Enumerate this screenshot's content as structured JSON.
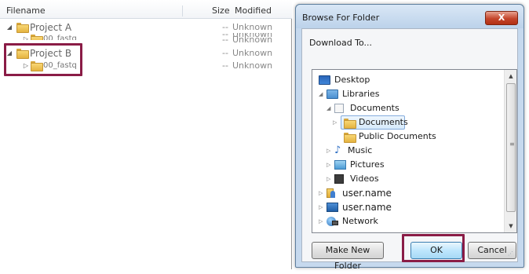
{
  "file_panel": {
    "columns": {
      "filename": "Filename",
      "size": "Size",
      "modified": "Modified"
    },
    "rows": [
      {
        "name": "Project A",
        "size": "--",
        "modified": "Unknown",
        "level": 0,
        "expanded": true
      },
      {
        "name": "00_fastq",
        "size": "--",
        "modified": "Unknown",
        "level": 1,
        "expanded": false
      },
      {
        "name": "Project B",
        "size": "--",
        "modified": "Unknown",
        "level": 0,
        "expanded": true
      },
      {
        "name": "00_fastq",
        "size": "--",
        "modified": "Unknown",
        "level": 1,
        "expanded": false
      }
    ]
  },
  "dialog": {
    "title": "Browse For Folder",
    "close_label": "X",
    "subtitle": "Download To...",
    "tree": [
      {
        "label": "Desktop",
        "icon": "desktop-icon",
        "caret": ""
      },
      {
        "label": "Libraries",
        "icon": "libraries-icon",
        "caret": "expanded"
      },
      {
        "label": "Documents",
        "icon": "documents-library-icon",
        "caret": "expanded"
      },
      {
        "label": "Documents",
        "icon": "folder-icon",
        "caret": "collapsed",
        "selected": true
      },
      {
        "label": "Public Documents",
        "icon": "folder-icon",
        "caret": ""
      },
      {
        "label": "Music",
        "icon": "music-icon",
        "caret": "collapsed"
      },
      {
        "label": "Pictures",
        "icon": "pictures-icon",
        "caret": "collapsed"
      },
      {
        "label": "Videos",
        "icon": "videos-icon",
        "caret": "collapsed"
      },
      {
        "label": "user.name",
        "icon": "user-folder-icon",
        "caret": "collapsed"
      },
      {
        "label": "user.name",
        "icon": "computer-icon",
        "caret": "collapsed"
      },
      {
        "label": "Network",
        "icon": "network-icon",
        "caret": "collapsed"
      }
    ],
    "buttons": {
      "make_new_folder": "Make New Folder",
      "ok": "OK",
      "cancel": "Cancel"
    }
  },
  "colors": {
    "highlight_border": "#8a1c46",
    "dialog_frame": "#c6d9ee",
    "close_button": "#c4452b"
  }
}
